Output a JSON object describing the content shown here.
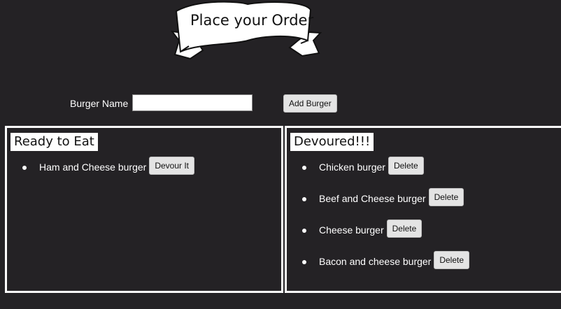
{
  "header": {
    "title": "Place your Order"
  },
  "form": {
    "label": "Burger Name",
    "input_value": "",
    "input_placeholder": "",
    "add_button": "Add Burger"
  },
  "ready": {
    "heading": "Ready to Eat",
    "items": [
      {
        "name": "Ham and Cheese burger",
        "action": "Devour It"
      }
    ]
  },
  "devoured": {
    "heading": "Devoured!!!",
    "items": [
      {
        "name": "Chicken burger",
        "action": "Delete"
      },
      {
        "name": "Beef and Cheese burger",
        "action": "Delete"
      },
      {
        "name": "Cheese burger",
        "action": "Delete"
      },
      {
        "name": "Bacon and cheese burger",
        "action": "Delete"
      }
    ]
  },
  "colors": {
    "background": "#242225",
    "panel_border": "#ffffff",
    "button_bg": "#e4e4e4"
  }
}
